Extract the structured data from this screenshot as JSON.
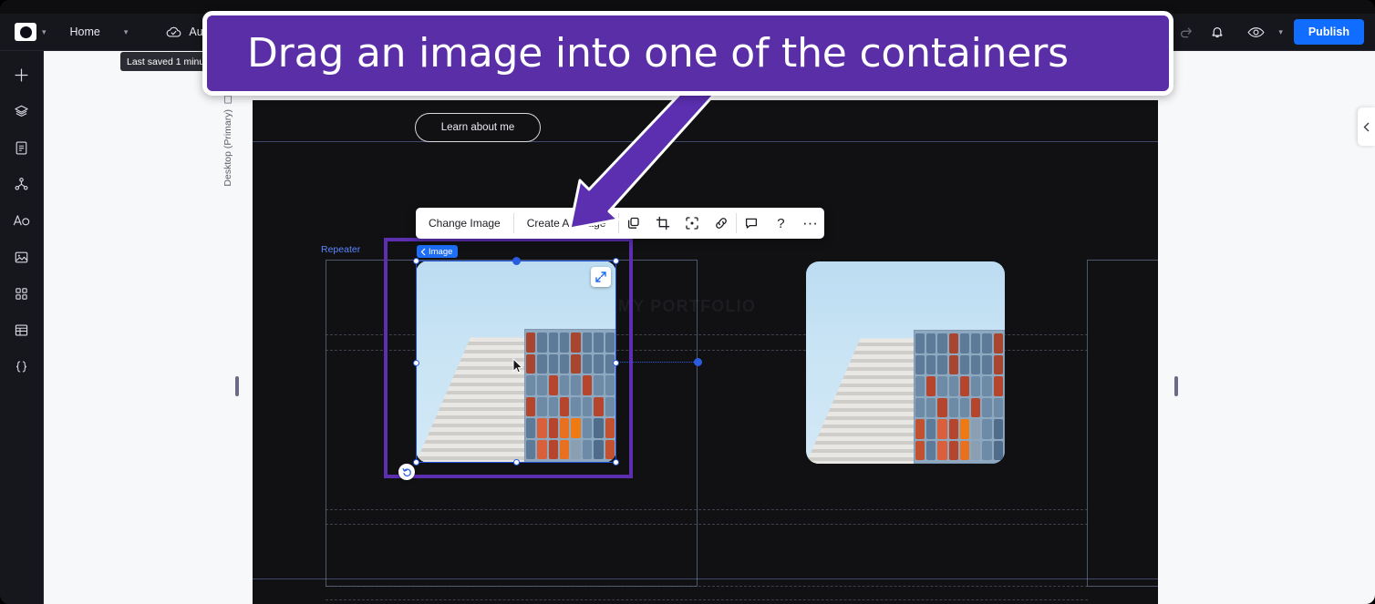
{
  "app": {
    "topbar": {
      "logo_icon": "wix-logo-icon",
      "logo_caret_icon": "chevron-down-icon",
      "menu_label": "Home",
      "menu_caret_icon": "chevron-down-icon",
      "autosave_icon": "cloud-check-icon",
      "autosave_label": "Autosave on",
      "undo_icon": "undo-icon",
      "redo_icon": "redo-icon",
      "notifications_icon": "bell-icon",
      "preview_icon": "eye-icon",
      "preview_caret_icon": "chevron-down-icon",
      "publish_label": "Publish"
    },
    "tooltip": {
      "text": "Last saved 1 minute ago"
    },
    "left_rail": [
      {
        "name": "add-elements",
        "icon": "plus-icon"
      },
      {
        "name": "layers",
        "icon": "layers-icon"
      },
      {
        "name": "pages",
        "icon": "page-icon"
      },
      {
        "name": "site-structure",
        "icon": "structure-icon"
      },
      {
        "name": "theme-text",
        "icon": "text-theme-icon"
      },
      {
        "name": "media",
        "icon": "image-icon"
      },
      {
        "name": "apps",
        "icon": "apps-grid-icon"
      },
      {
        "name": "cms",
        "icon": "table-icon"
      },
      {
        "name": "dev-mode",
        "icon": "code-braces-icon"
      }
    ],
    "stage": {
      "viewport_label": "Desktop (Primary)",
      "viewport_icon": "monitor-icon",
      "collapse_icon": "chevron-left-icon",
      "left_resize_handle": "stage-resize-handle-left",
      "right_resize_handle": "stage-resize-handle-right"
    }
  },
  "canvas": {
    "learn_button_label": "Learn about me",
    "ghost_heading": "MY PORTFOLIO",
    "repeater_label": "Repeater",
    "selected_element_badge": {
      "back_icon": "chevron-left-icon",
      "label": "Image"
    },
    "expand_icon": "expand-arrows-icon",
    "reset_icon": "reset-crop-icon",
    "cursor_icon": "mouse-pointer-icon"
  },
  "float_toolbar": {
    "change_image_label": "Change Image",
    "create_ai_image_label": "Create AI Image",
    "icons": [
      {
        "name": "duplicate-icon",
        "title": "Duplicate"
      },
      {
        "name": "crop-icon",
        "title": "Crop"
      },
      {
        "name": "focal-point-icon",
        "title": "Set focal point"
      },
      {
        "name": "link-icon",
        "title": "Link"
      },
      {
        "name": "comment-icon",
        "title": "Comment"
      },
      {
        "name": "help-icon",
        "title": "Help"
      },
      {
        "name": "more-icon",
        "title": "More"
      }
    ]
  },
  "callout": {
    "text": "Drag an image into one of the containers",
    "background": "#5a2ea6",
    "border": "#ffffff",
    "arrow_color": "#5b2fb0"
  },
  "colors": {
    "accent_blue": "#116dff",
    "selection_blue": "#2a5ce0",
    "purple": "#5b2fb0",
    "topbar": "#16161d",
    "canvas_bg": "#111113"
  }
}
